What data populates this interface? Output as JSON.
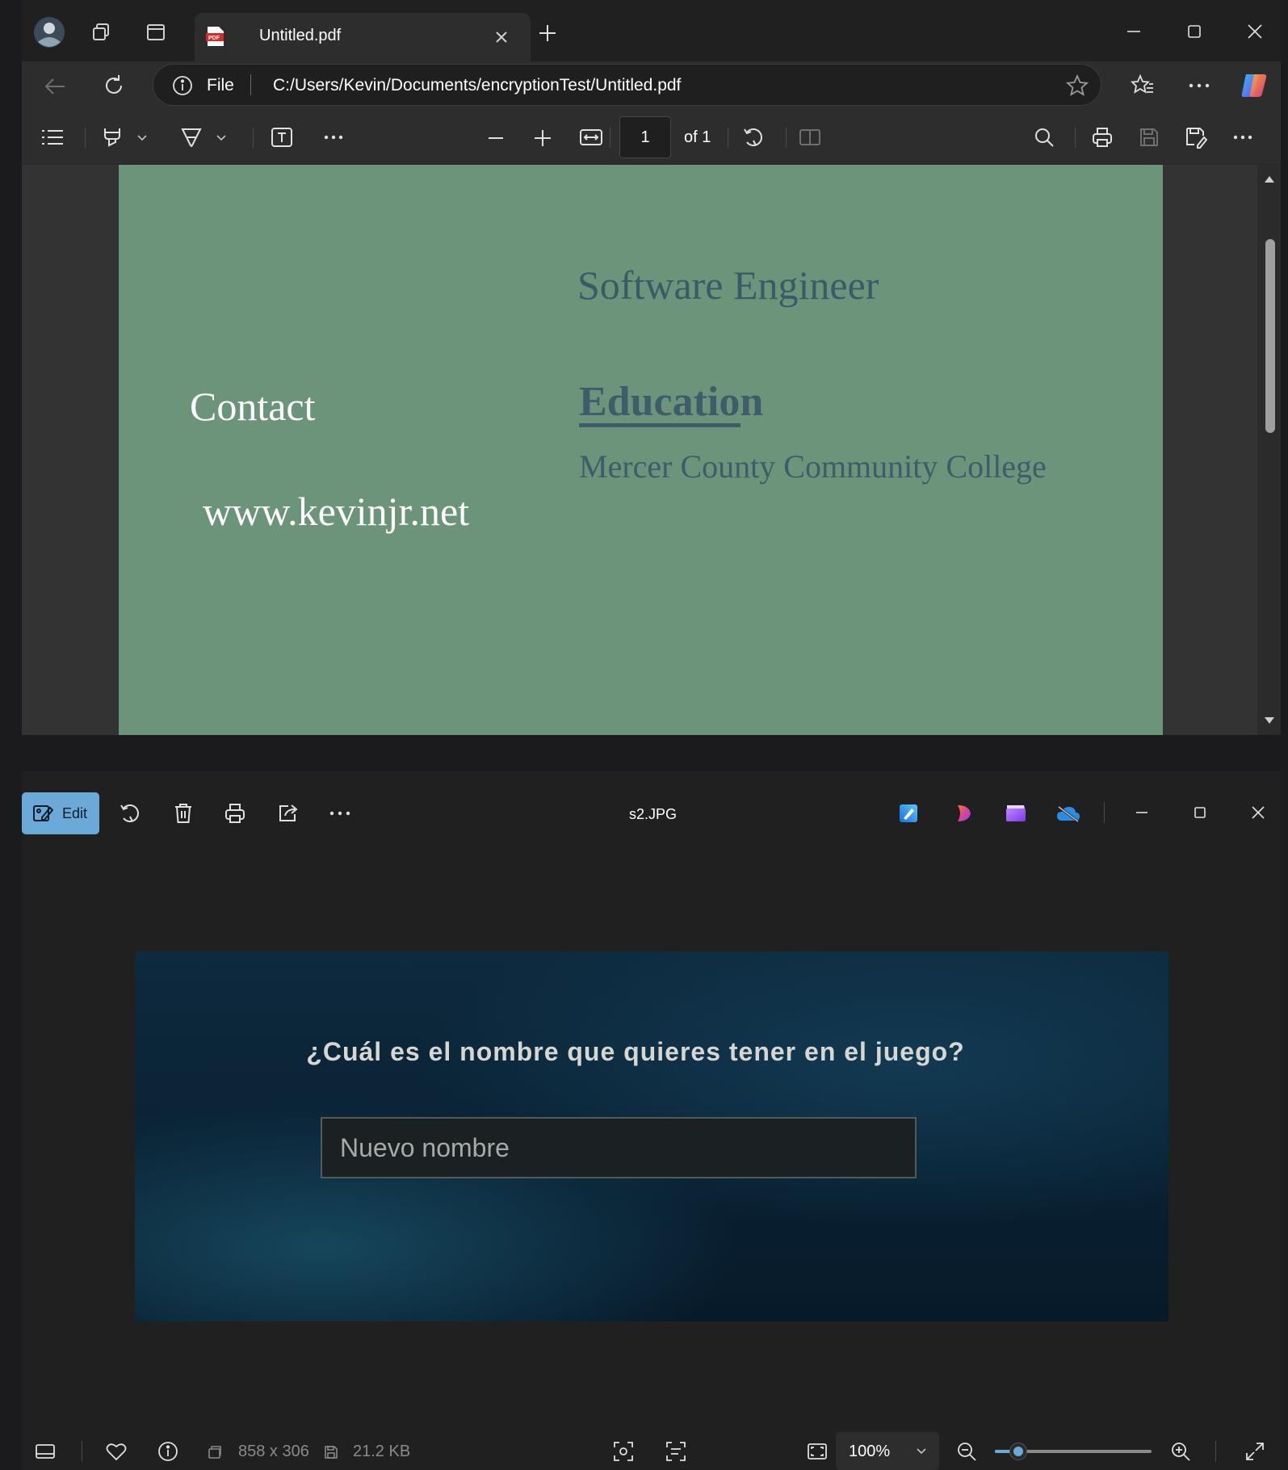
{
  "browser": {
    "tab_title": "Untitled.pdf",
    "address_scheme": "File",
    "address_url": "C:/Users/Kevin/Documents/encryptionTest/Untitled.pdf",
    "pdf_toolbar": {
      "page_number": "1",
      "page_of": "of 1"
    }
  },
  "pdf": {
    "role": "Software Engineer",
    "contact_heading": "Contact",
    "education_heading": "Education",
    "school": "Mercer County Community College",
    "website": "www.kevinjr.net",
    "page_color": "#6b947a"
  },
  "photos": {
    "edit_label": "Edit",
    "file_name": "s2.JPG",
    "image": {
      "question": "¿Cuál es el nombre que quieres tener en el juego?",
      "input_placeholder": "Nuevo nombre"
    },
    "status": {
      "dimensions": "858 x 306",
      "file_size": "21.2 KB",
      "zoom": "100%",
      "zoom_level": 0.15
    },
    "accent": "#6aa9d8"
  }
}
